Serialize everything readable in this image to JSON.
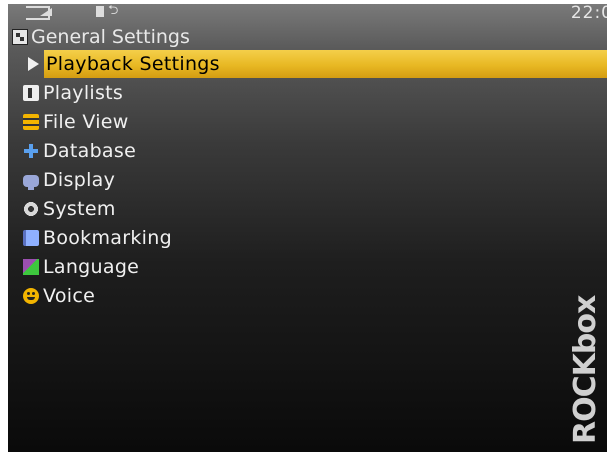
{
  "status": {
    "clock": "22:0"
  },
  "header": {
    "title": "General Settings",
    "icon": "settings-icon"
  },
  "menu": {
    "selected_index": 0,
    "items": [
      {
        "label": "Playback Settings",
        "icon": "play-cursor-icon"
      },
      {
        "label": "Playlists",
        "icon": "playlist-icon"
      },
      {
        "label": "File View",
        "icon": "folder-icon"
      },
      {
        "label": "Database",
        "icon": "database-plus-icon"
      },
      {
        "label": "Display",
        "icon": "display-icon"
      },
      {
        "label": "System",
        "icon": "gear-icon"
      },
      {
        "label": "Bookmarking",
        "icon": "bookmark-icon"
      },
      {
        "label": "Language",
        "icon": "language-icon"
      },
      {
        "label": "Voice",
        "icon": "voice-icon"
      }
    ]
  },
  "logo": {
    "text": "ROCKbox"
  },
  "colors": {
    "highlight": "#e8b823",
    "text": "#f0f0f0",
    "background_top": "#7a7a7a",
    "background_bottom": "#0a0a0a"
  }
}
